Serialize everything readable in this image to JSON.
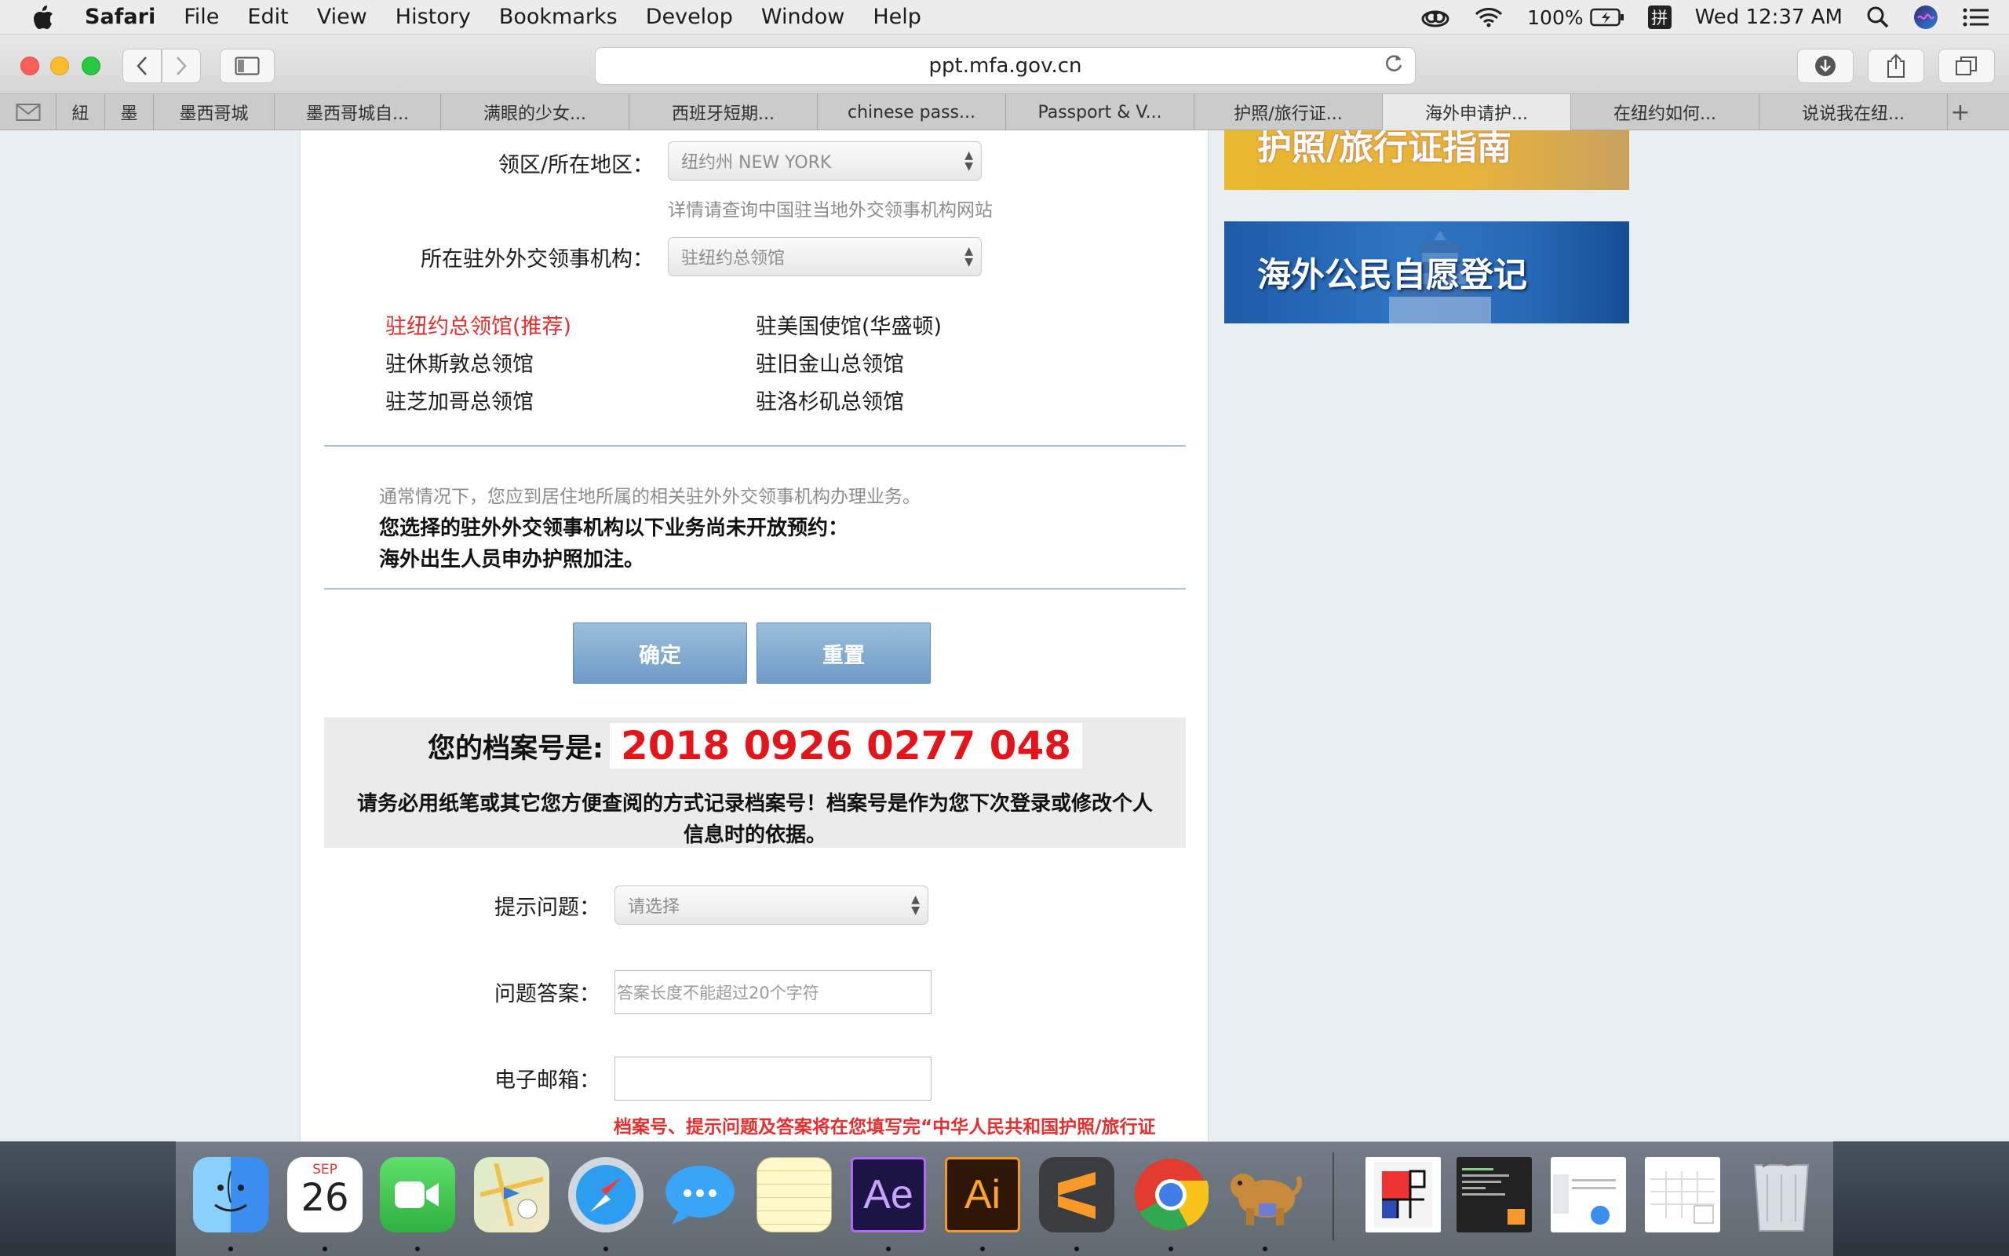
{
  "menubar": {
    "app": "Safari",
    "items": [
      "File",
      "Edit",
      "View",
      "History",
      "Bookmarks",
      "Develop",
      "Window",
      "Help"
    ],
    "battery": "100%",
    "input_method": "拼",
    "clock": "Wed 12:37 AM"
  },
  "toolbar": {
    "url": "ppt.mfa.gov.cn"
  },
  "tabs": [
    "紐",
    "墨",
    "墨西哥城",
    "墨西哥城自...",
    "满眼的少女...",
    "西班牙短期...",
    "chinese pass...",
    "Passport & V...",
    "护照/旅行证...",
    "海外申请护...",
    "在纽约如何...",
    "说说我在纽..."
  ],
  "form": {
    "region_label": "领区/所在地区：",
    "region_value": "纽约州 NEW YORK",
    "region_hint": "详情请查询中国驻当地外交领事机构网站",
    "consulate_label": "所在驻外外交领事机构：",
    "consulate_value": "驻纽约总领馆",
    "consulates": [
      "驻纽约总领馆(推荐)",
      "驻美国使馆(华盛顿)",
      "驻休斯敦总领馆",
      "驻旧金山总领馆",
      "驻芝加哥总领馆",
      "驻洛杉矶总领馆"
    ],
    "notice_grey": "通常情况下，您应到居住地所属的相关驻外外交领事机构办理业务。",
    "notice_bold_1": "您选择的驻外外交领事机构以下业务尚未开放预约：",
    "notice_bold_2": "海外出生人员申办护照加注。",
    "confirm_button": "确定",
    "reset_button": "重置",
    "archive_label": "您的档案号是:",
    "archive_number": "2018 0926 0277 048",
    "archive_warning_1": "请务必用纸笔或其它您方便查阅的方式记录档案号！档案号是作为您下次登录或修改个人",
    "archive_warning_2": "信息时的依据。",
    "question_label": "提示问题：",
    "question_placeholder": "请选择",
    "answer_label": "问题答案：",
    "answer_placeholder": "答案长度不能超过20个字符",
    "email_label": "电子邮箱：",
    "email_value": "",
    "bottom_note": "档案号、提示问题及答案将在您填写完“中华人民共和国护照/旅行证"
  },
  "sidebar": {
    "banner1": "护照/旅行证指南",
    "banner2": "海外公民自愿登记"
  },
  "dock": {
    "calendar_month": "SEP",
    "calendar_day": "26",
    "ae": "Ae",
    "ai": "Ai"
  },
  "colors": {
    "accent_red": "#e3151b",
    "button_blue": "#7fa8d1",
    "link_red": "#e62e2e"
  }
}
